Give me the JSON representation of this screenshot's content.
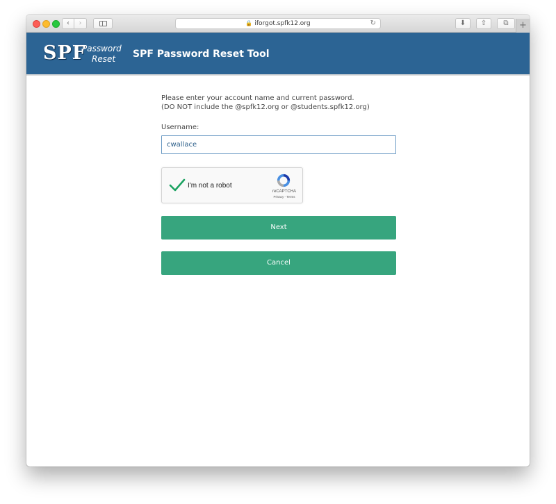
{
  "browser": {
    "address": "iforgot.spfk12.org",
    "back_glyph": "‹",
    "forward_glyph": "›",
    "reload_glyph": "↻",
    "download_glyph": "⬇",
    "share_glyph": "⇧",
    "tabs_glyph": "⧉",
    "new_tab_glyph": "+",
    "lock_glyph": "🔒"
  },
  "header": {
    "logo_text": "SPF",
    "logo_word1": "Password",
    "logo_word2": "Reset",
    "title": "SPF Password Reset Tool",
    "bg_color": "#2c6494"
  },
  "form": {
    "instruction_line1": "Please enter your account name and current password.",
    "instruction_line2": "(DO NOT include the @spfk12.org or @students.spfk12.org)",
    "username_label": "Username:",
    "username_value": "cwallace"
  },
  "recaptcha": {
    "label": "I'm not a robot",
    "brand": "reCAPTCHA",
    "links": "Privacy - Terms",
    "checked": true
  },
  "buttons": {
    "next_label": "Next",
    "cancel_label": "Cancel",
    "color": "#37a57e"
  }
}
